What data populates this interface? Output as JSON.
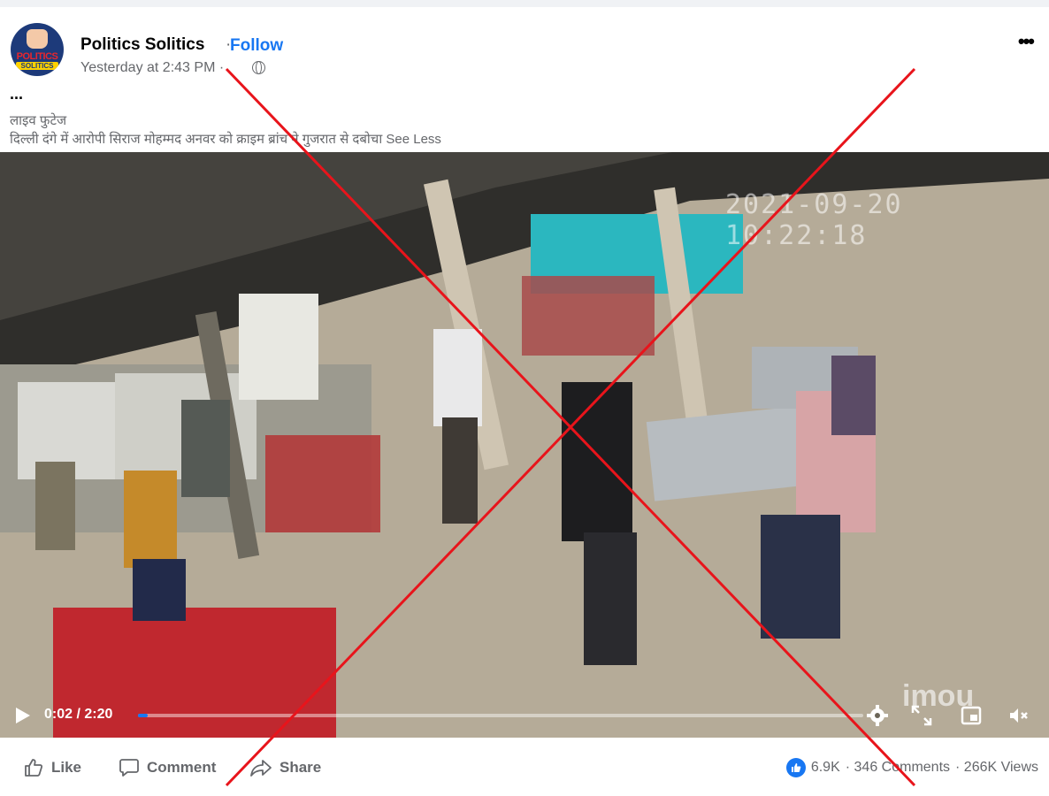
{
  "post": {
    "page_name": "Politics Solitics",
    "separator": "·",
    "follow_label": "Follow",
    "timestamp": "Yesterday at 2:43 PM ·",
    "avatar_text_line1": "POLITICS",
    "avatar_text_line2": "SOLITICS",
    "more_label": "•••",
    "ellipsis": "...",
    "caption_line1": "लाइव फुटेज",
    "caption_line2": "दिल्ली दंगे में आरोपी सिराज मोहम्मद अनवर को क्राइम ब्रांच ने गुजरात से दबोचा",
    "see_less": "See Less"
  },
  "video": {
    "camera_timestamp": "2021-09-20 10:22:18",
    "watermark": "imou",
    "time_readout": "0:02 / 2:20",
    "progress_fraction": 0.014
  },
  "actions": {
    "like": "Like",
    "comment": "Comment",
    "share": "Share"
  },
  "stats": {
    "reactions": "6.9K",
    "comments": "· 346 Comments",
    "views": "· 266K Views"
  },
  "colors": {
    "brand_blue": "#1877f2",
    "overlay_red": "#e8141b",
    "text_secondary": "#65676b"
  }
}
